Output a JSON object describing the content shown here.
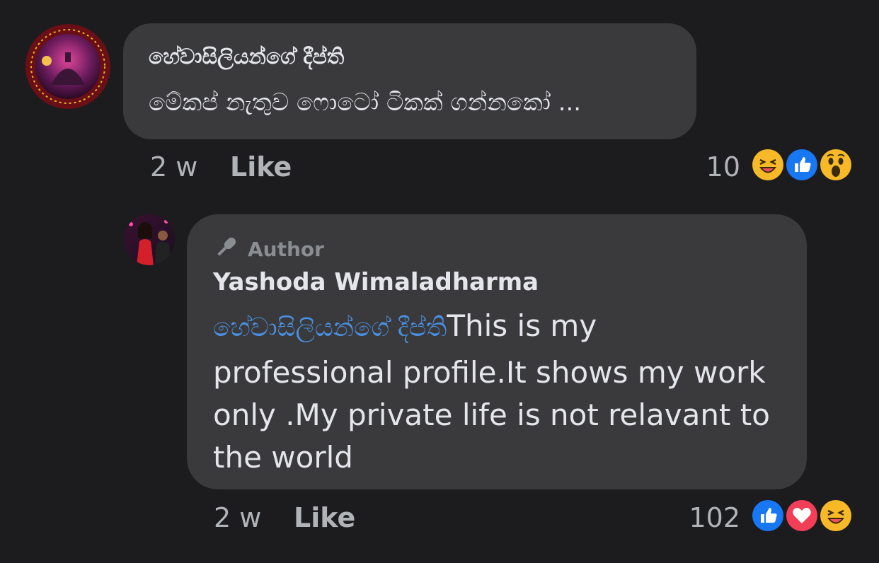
{
  "comments": [
    {
      "author": "හේවාසිලියන්ගේ දීප්ති",
      "text": "මේකප් නැතුව ෆොටෝ ටිකක් ගන්නකෝ ...",
      "time": "2 w",
      "like_label": "Like",
      "reaction_count": "10",
      "reactions": [
        "haha",
        "like",
        "wow"
      ]
    },
    {
      "badge": "Author",
      "author": "Yashoda Wimaladharma",
      "mention": "හේවාසිලියන්ගේ දීප්ති",
      "text_lines": [
        "This is my",
        "professional profile.It shows my work",
        "only .My private life is not relavant to",
        "the world"
      ],
      "time": "2 w",
      "like_label": "Like",
      "reaction_count": "102",
      "reactions": [
        "like",
        "love",
        "haha"
      ]
    }
  ],
  "colors": {
    "background": "#1c1c1e",
    "bubble": "#3a3a3c",
    "mention": "#4a90e2",
    "meta": "#b0b3b8",
    "like_reaction": "#1877f2",
    "love_reaction": "#f33e58",
    "emoji_yellow": "#f7b928"
  }
}
